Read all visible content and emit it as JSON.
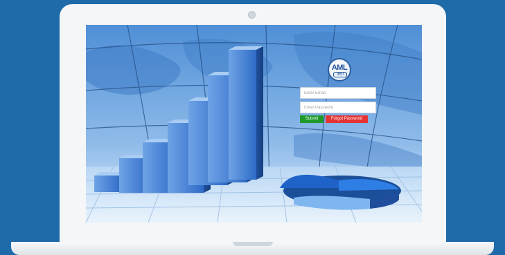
{
  "login": {
    "logo_text": "AML",
    "logo_sub": "360",
    "email_placeholder": "Enter Email",
    "password_placeholder": "Enter Password",
    "submit_label": "Submit",
    "forgot_label": "Forgot Password"
  },
  "colors": {
    "page_background": "#1f6aa8",
    "submit_button": "#1f9a2a",
    "forgot_button": "#e53232",
    "bars": "#2f6fd0"
  }
}
